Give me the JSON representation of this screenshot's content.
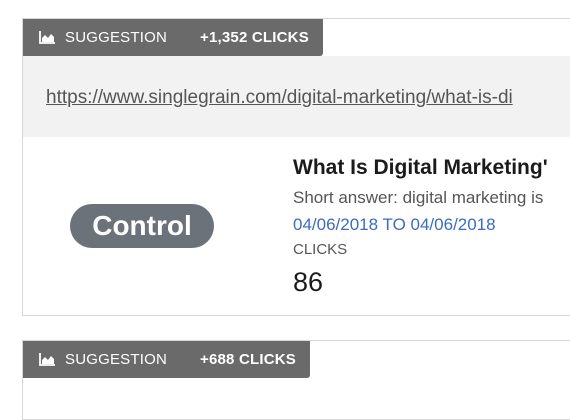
{
  "suggestions": [
    {
      "icon": "area-chart-icon",
      "label": "SUGGESTION",
      "clicks": "+1,352 CLICKS",
      "url": "https://www.singlegrain.com/digital-marketing/what-is-di",
      "badge": "Control",
      "title": "What Is Digital Marketing'",
      "snippet": "Short answer: digital marketing is",
      "date_range": "04/06/2018 TO 04/06/2018",
      "metric_label": "CLICKS",
      "metric_value": "86"
    },
    {
      "icon": "area-chart-icon",
      "label": "SUGGESTION",
      "clicks": "+688 CLICKS"
    }
  ],
  "colors": {
    "tag_background": "#6a6a6a",
    "url_band": "#f2f2f2",
    "badge_background": "#6b7279",
    "date_link": "#3b6cc0"
  }
}
